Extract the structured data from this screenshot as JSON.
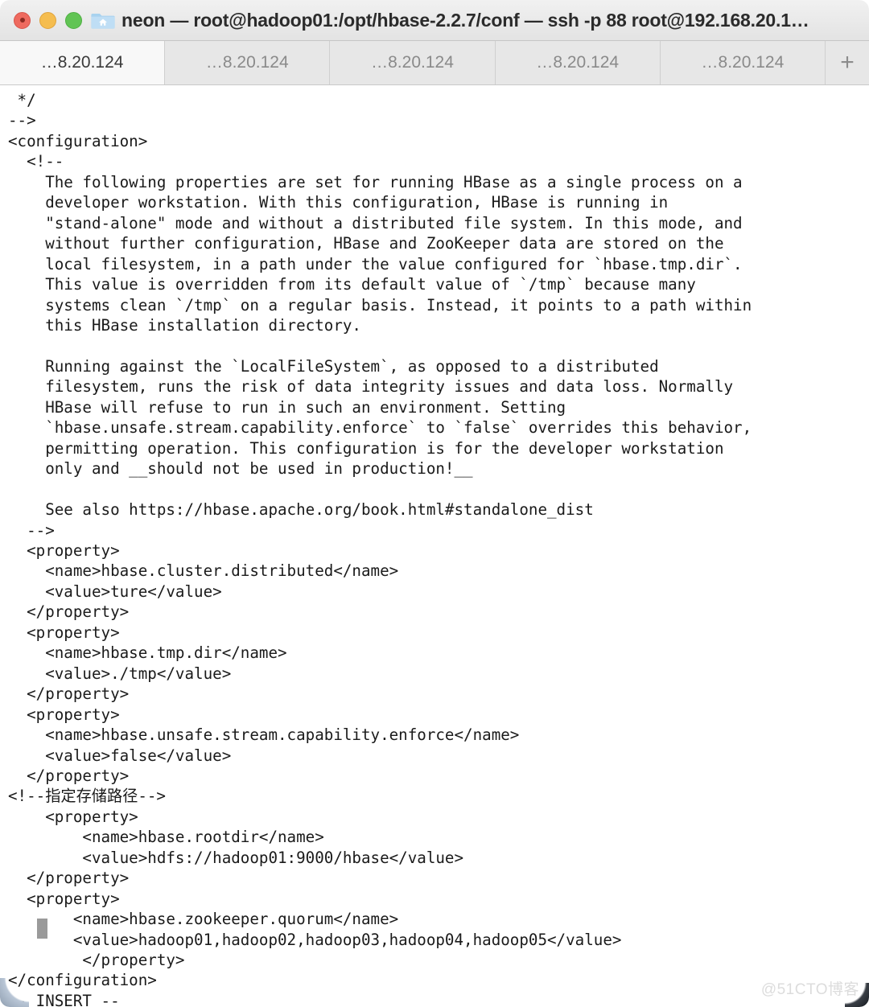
{
  "window": {
    "title": "neon — root@hadoop01:/opt/hbase-2.2.7/conf — ssh -p 88 root@192.168.20.1…",
    "folder_icon": "folder-home-icon",
    "controls": {
      "close": "close-window-button",
      "minimize": "minimize-window-button",
      "maximize": "maximize-window-button"
    }
  },
  "tabs": {
    "items": [
      {
        "label": "…8.20.124",
        "active": true
      },
      {
        "label": "…8.20.124",
        "active": false
      },
      {
        "label": "…8.20.124",
        "active": false
      },
      {
        "label": "…8.20.124",
        "active": false
      },
      {
        "label": "…8.20.124",
        "active": false
      }
    ],
    "new_tab_label": "+"
  },
  "editor": {
    "mode_line": "-- INSERT --",
    "cursor": {
      "line": 38,
      "column": 3
    },
    "content": " */\n-->\n<configuration>\n  <!--\n    The following properties are set for running HBase as a single process on a\n    developer workstation. With this configuration, HBase is running in\n    \"stand-alone\" mode and without a distributed file system. In this mode, and\n    without further configuration, HBase and ZooKeeper data are stored on the\n    local filesystem, in a path under the value configured for `hbase.tmp.dir`.\n    This value is overridden from its default value of `/tmp` because many\n    systems clean `/tmp` on a regular basis. Instead, it points to a path within\n    this HBase installation directory.\n\n    Running against the `LocalFileSystem`, as opposed to a distributed\n    filesystem, runs the risk of data integrity issues and data loss. Normally\n    HBase will refuse to run in such an environment. Setting\n    `hbase.unsafe.stream.capability.enforce` to `false` overrides this behavior,\n    permitting operation. This configuration is for the developer workstation\n    only and __should not be used in production!__\n\n    See also https://hbase.apache.org/book.html#standalone_dist\n  -->\n  <property>\n    <name>hbase.cluster.distributed</name>\n    <value>ture</value>\n  </property>\n  <property>\n    <name>hbase.tmp.dir</name>\n    <value>./tmp</value>\n  </property>\n  <property>\n    <name>hbase.unsafe.stream.capability.enforce</name>\n    <value>false</value>\n  </property>\n<!--指定存储路径-->\n    <property>\n        <name>hbase.rootdir</name>\n        <value>hdfs://hadoop01:9000/hbase</value>\n  </property>\n  <property>\n       <name>hbase.zookeeper.quorum</name>\n       <value>hadoop01,hadoop02,hadoop03,hadoop04,hadoop05</value>\n        </property>\n</configuration>"
  },
  "watermark": {
    "text": "@51CTO博客"
  },
  "colors": {
    "titlebar_bg": "#ececec",
    "tab_active_bg": "#f8f8f8",
    "tab_inactive_bg": "#e7e7e7",
    "terminal_bg": "#ffffff",
    "terminal_fg": "#1a1a1a",
    "cursor": "#9a9a9a",
    "close_dot": "#ee6a5f",
    "minimize_dot": "#f5bd4f",
    "maximize_dot": "#61c454"
  }
}
